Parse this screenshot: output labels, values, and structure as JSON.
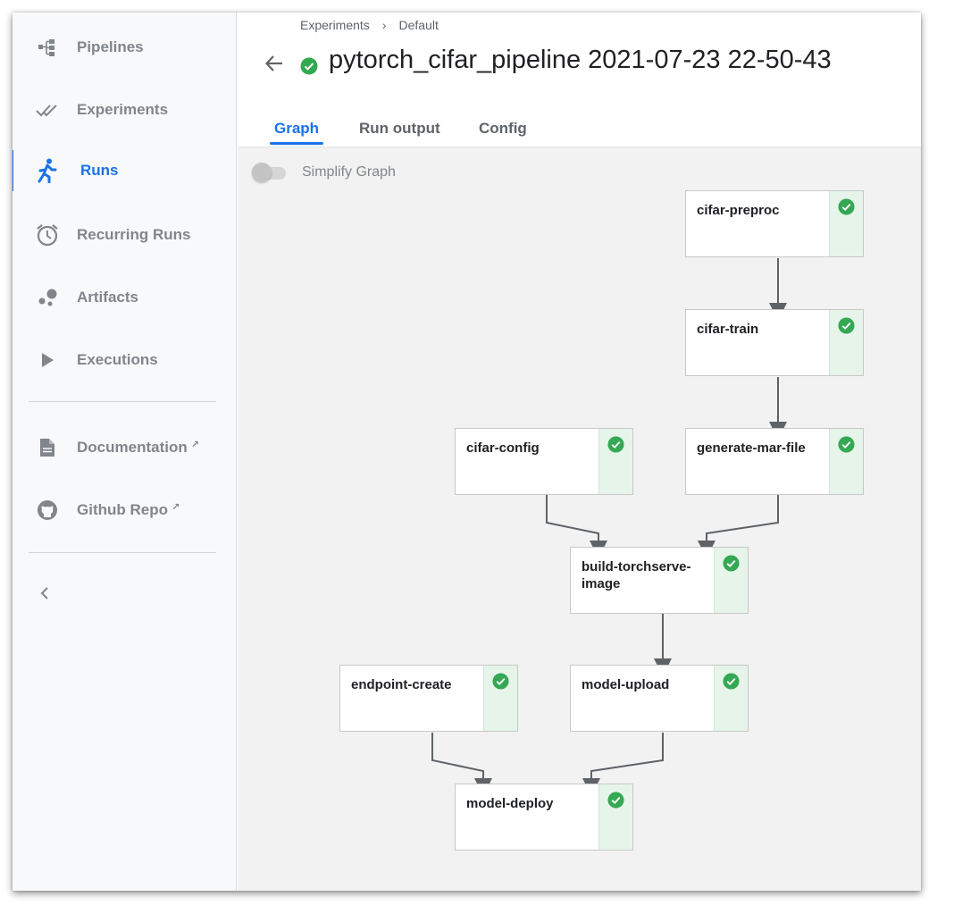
{
  "sidebar": {
    "items": [
      {
        "label": "Pipelines",
        "icon": "pipelines-icon"
      },
      {
        "label": "Experiments",
        "icon": "experiments-icon"
      },
      {
        "label": "Runs",
        "icon": "runs-icon",
        "active": true
      },
      {
        "label": "Recurring Runs",
        "icon": "alarm-clock-icon"
      },
      {
        "label": "Artifacts",
        "icon": "artifacts-icon"
      },
      {
        "label": "Executions",
        "icon": "play-icon"
      }
    ],
    "links": [
      {
        "label": "Documentation",
        "icon": "document-icon",
        "external": true
      },
      {
        "label": "Github Repo",
        "icon": "github-icon",
        "external": true
      }
    ],
    "collapse_icon": "chevron-left-icon"
  },
  "header": {
    "breadcrumb": [
      "Experiments",
      "Default"
    ],
    "breadcrumb_separator": "›",
    "title": "pytorch_cifar_pipeline 2021-07-23 22-50-43",
    "status": "succeeded"
  },
  "tabs": [
    {
      "label": "Graph",
      "active": true
    },
    {
      "label": "Run output"
    },
    {
      "label": "Config"
    }
  ],
  "graph": {
    "simplify_label": "Simplify Graph",
    "simplify_on": false,
    "nodes": [
      {
        "label": "cifar-preproc",
        "status": "succeeded"
      },
      {
        "label": "cifar-train",
        "status": "succeeded"
      },
      {
        "label": "cifar-config",
        "status": "succeeded"
      },
      {
        "label": "generate-mar-file",
        "status": "succeeded"
      },
      {
        "label": "build-torchserve-image",
        "status": "succeeded"
      },
      {
        "label": "endpoint-create",
        "status": "succeeded"
      },
      {
        "label": "model-upload",
        "status": "succeeded"
      },
      {
        "label": "model-deploy",
        "status": "succeeded"
      }
    ],
    "edges": [
      [
        "cifar-preproc",
        "cifar-train"
      ],
      [
        "cifar-train",
        "generate-mar-file"
      ],
      [
        "cifar-config",
        "build-torchserve-image"
      ],
      [
        "generate-mar-file",
        "build-torchserve-image"
      ],
      [
        "build-torchserve-image",
        "model-upload"
      ],
      [
        "endpoint-create",
        "model-deploy"
      ],
      [
        "model-upload",
        "model-deploy"
      ]
    ]
  },
  "colors": {
    "accent": "#1a73e8",
    "success": "#34a853",
    "success_bg": "#e6f4ea",
    "muted": "#80868b"
  }
}
